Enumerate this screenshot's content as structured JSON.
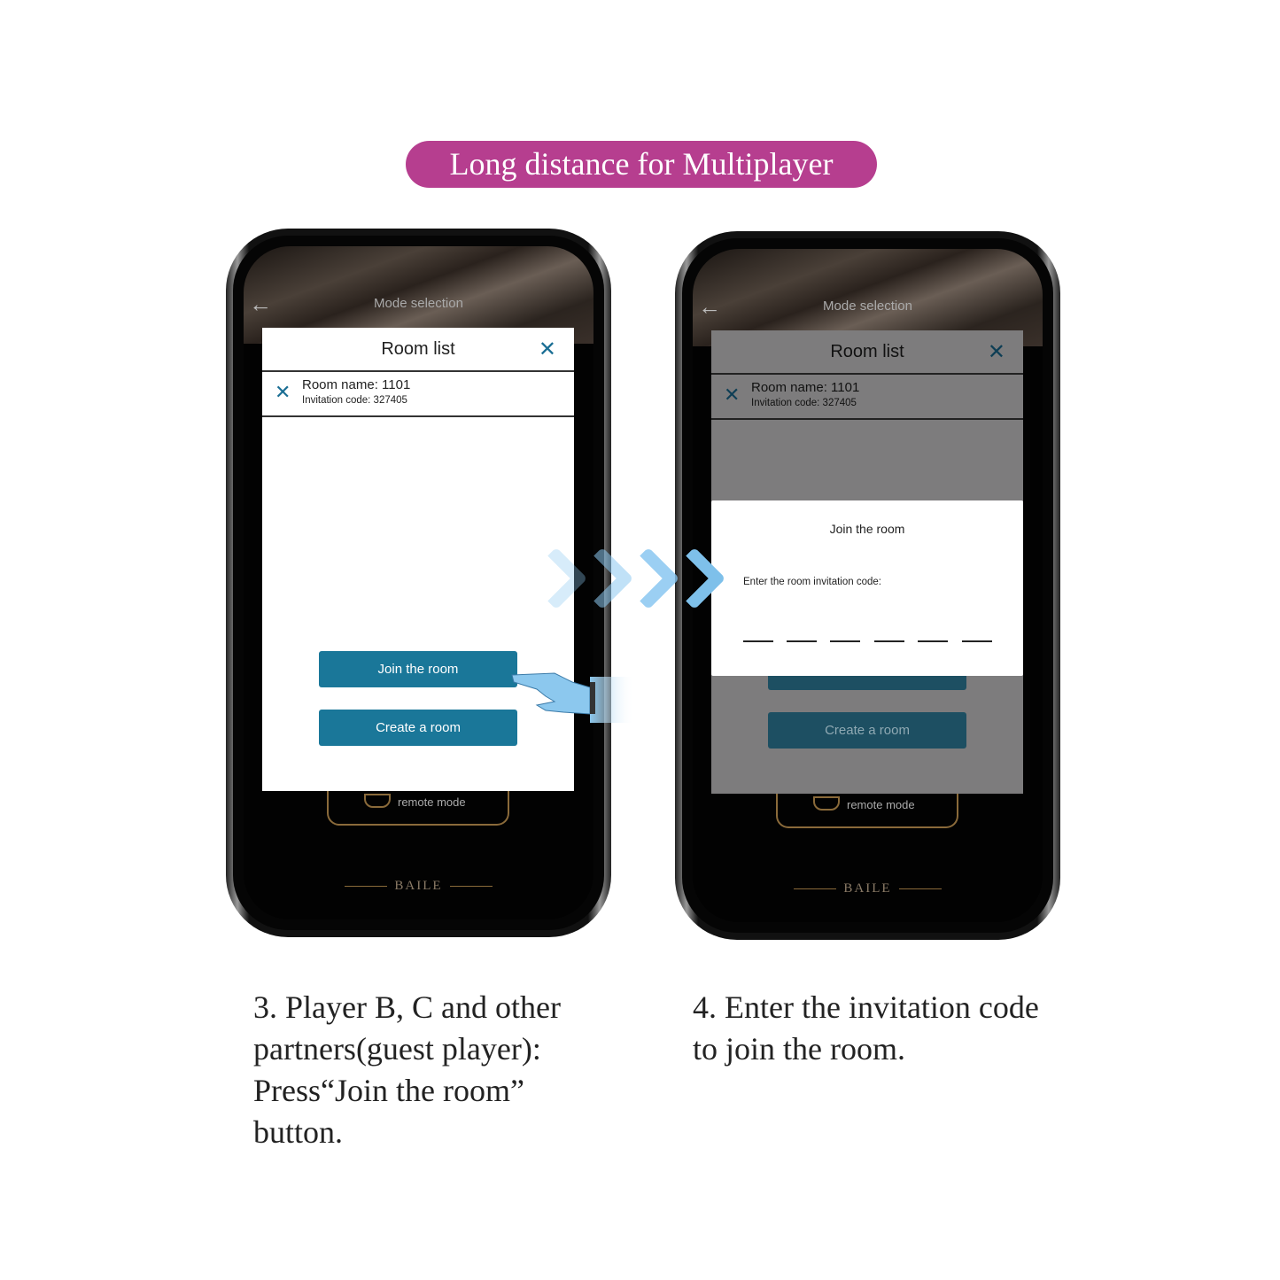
{
  "banner": "Long distance for Multiplayer",
  "brand_color": "#b63e8f",
  "accent_color": "#1a7799",
  "phone1": {
    "header_title": "Mode selection",
    "back_icon": "arrow-left",
    "modal": {
      "title": "Room list",
      "close_icon": "x",
      "room_name": "Room name: 1101",
      "invitation_code": "Invitation code:  327405"
    },
    "join_button": "Join the room",
    "create_button": "Create a room",
    "remote_mode": "remote mode",
    "logo": "BAILE"
  },
  "phone2": {
    "header_title": "Mode selection",
    "modal": {
      "title": "Room list",
      "room_name": "Room name: 1101",
      "invitation_code": "Invitation code:  327405"
    },
    "create_button": "Create a room",
    "remote_mode": "remote mode",
    "logo": "BAILE",
    "dialog": {
      "title": "Join the room",
      "label": "Enter the room invitation code:",
      "code_slots": 6
    }
  },
  "captions": {
    "step3": [
      "3. Player B, C and other",
      "partners(guest player):",
      "Press“Join the room”",
      "button."
    ],
    "step4": [
      "4. Enter the invitation code",
      "to join the room."
    ]
  }
}
